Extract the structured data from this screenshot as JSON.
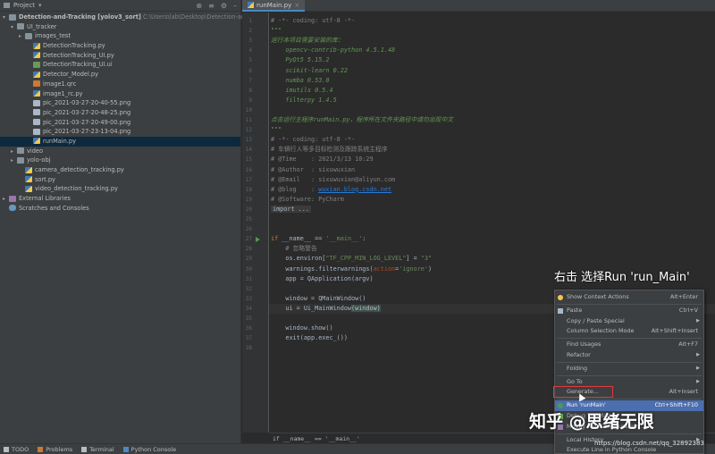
{
  "project": {
    "header_label": "Project",
    "tree": [
      {
        "depth": 0,
        "arrow": "▾",
        "icon": "folder",
        "label": "Detection-and-Tracking [yolov3_sort]",
        "extra": "C:\\Users\\lab\\Desktop\\Detection-and-Trac"
      },
      {
        "depth": 1,
        "arrow": "▾",
        "icon": "folder",
        "label": "UI_tracker"
      },
      {
        "depth": 2,
        "arrow": "▸",
        "icon": "folder",
        "label": "images_test"
      },
      {
        "depth": 3,
        "arrow": "",
        "icon": "py",
        "label": "DetectionTracking.py"
      },
      {
        "depth": 3,
        "arrow": "",
        "icon": "py",
        "label": "DetectionTracking_UI.py"
      },
      {
        "depth": 3,
        "arrow": "",
        "icon": "ui",
        "label": "DetectionTracking_UI.ui"
      },
      {
        "depth": 3,
        "arrow": "",
        "icon": "py",
        "label": "Detector_Model.py"
      },
      {
        "depth": 3,
        "arrow": "",
        "icon": "qrc",
        "label": "image1.qrc"
      },
      {
        "depth": 3,
        "arrow": "",
        "icon": "py",
        "label": "image1_rc.py"
      },
      {
        "depth": 3,
        "arrow": "",
        "icon": "png",
        "label": "pic_2021-03-27-20-40-55.png"
      },
      {
        "depth": 3,
        "arrow": "",
        "icon": "png",
        "label": "pic_2021-03-27-20-48-25.png"
      },
      {
        "depth": 3,
        "arrow": "",
        "icon": "png",
        "label": "pic_2021-03-27-20-49-00.png"
      },
      {
        "depth": 3,
        "arrow": "",
        "icon": "png",
        "label": "pic_2021-03-27-23-13-04.png"
      },
      {
        "depth": 3,
        "arrow": "",
        "icon": "py",
        "label": "runMain.py",
        "selected": true
      },
      {
        "depth": 1,
        "arrow": "▸",
        "icon": "folder",
        "label": "video"
      },
      {
        "depth": 1,
        "arrow": "▸",
        "icon": "folder",
        "label": "yolo-obj"
      },
      {
        "depth": 2,
        "arrow": "",
        "icon": "py",
        "label": "camera_detection_tracking.py"
      },
      {
        "depth": 2,
        "arrow": "",
        "icon": "py",
        "label": "sort.py"
      },
      {
        "depth": 2,
        "arrow": "",
        "icon": "py",
        "label": "video_detection_tracking.py"
      },
      {
        "depth": 0,
        "arrow": "▸",
        "icon": "lib",
        "label": "External Libraries"
      },
      {
        "depth": 0,
        "arrow": "",
        "icon": "scratch",
        "label": "Scratches and Consoles"
      }
    ]
  },
  "editor": {
    "tab_label": "runMain.py",
    "lines": [
      {
        "n": "1",
        "parts": [
          [
            "c-comment",
            "# -*- coding: utf-8 -*-"
          ]
        ]
      },
      {
        "n": "2",
        "parts": [
          [
            "c-doc",
            "\"\"\""
          ]
        ]
      },
      {
        "n": "3",
        "parts": [
          [
            "c-doc",
            "运行本项目需要安装的库："
          ]
        ]
      },
      {
        "n": "4",
        "parts": [
          [
            "c-doc",
            "    opencv-contrib-python 4.5.1.48"
          ]
        ]
      },
      {
        "n": "5",
        "parts": [
          [
            "c-doc",
            "    PyQt5 5.15.2"
          ]
        ]
      },
      {
        "n": "6",
        "parts": [
          [
            "c-doc",
            "    scikit-learn 0.22"
          ]
        ]
      },
      {
        "n": "7",
        "parts": [
          [
            "c-doc",
            "    numba 0.53.0"
          ]
        ]
      },
      {
        "n": "8",
        "parts": [
          [
            "c-doc",
            "    imutils 0.5.4"
          ]
        ]
      },
      {
        "n": "9",
        "parts": [
          [
            "c-doc",
            "    filterpy 1.4.5"
          ]
        ]
      },
      {
        "n": "10",
        "parts": [
          [
            "c-doc",
            ""
          ]
        ]
      },
      {
        "n": "11",
        "parts": [
          [
            "c-doc",
            "点击运行主程序runMain.py，程序所在文件夹路径中请勿出现中文"
          ]
        ]
      },
      {
        "n": "12",
        "parts": [
          [
            "c-doc",
            "\"\"\""
          ]
        ]
      },
      {
        "n": "13",
        "parts": [
          [
            "c-comment",
            "# -*- coding: utf-8 -*-"
          ]
        ]
      },
      {
        "n": "14",
        "parts": [
          [
            "c-comment",
            "# 车辆行人等多目标检测及跟踪系统主程序"
          ]
        ]
      },
      {
        "n": "15",
        "parts": [
          [
            "c-comment",
            "# @Time    : 2021/3/13 10:29"
          ]
        ]
      },
      {
        "n": "16",
        "parts": [
          [
            "c-comment",
            "# @Author  : sixuwuxian"
          ]
        ]
      },
      {
        "n": "17",
        "parts": [
          [
            "c-comment",
            "# @Email   : sixuwuxian@aliyun.com"
          ]
        ]
      },
      {
        "n": "18",
        "parts": [
          [
            "c-comment",
            "# @blog    : "
          ],
          [
            "c-link",
            "wuxian.blog.csdn.net"
          ]
        ]
      },
      {
        "n": "19",
        "parts": [
          [
            "c-comment",
            "# @Software: PyCharm"
          ]
        ]
      },
      {
        "n": "20",
        "parts": [
          [
            "c-fold",
            "import ..."
          ]
        ]
      },
      {
        "n": "25",
        "parts": [
          [
            "c-plain",
            ""
          ]
        ]
      },
      {
        "n": "26",
        "parts": [
          [
            "c-plain",
            ""
          ]
        ]
      },
      {
        "n": "27",
        "parts": [
          [
            "c-kw",
            "if "
          ],
          [
            "c-plain",
            "__name__ == "
          ],
          [
            "c-str",
            "'__main__'"
          ],
          [
            "c-plain",
            ":"
          ]
        ]
      },
      {
        "n": "28",
        "parts": [
          [
            "c-comment",
            "    # 忽略警告"
          ]
        ]
      },
      {
        "n": "29",
        "parts": [
          [
            "c-plain",
            "    os.environ["
          ],
          [
            "c-str",
            "\"TF_CPP_MIN_LOG_LEVEL\""
          ],
          [
            "c-plain",
            "] = "
          ],
          [
            "c-str",
            "\"3\""
          ]
        ]
      },
      {
        "n": "30",
        "parts": [
          [
            "c-plain",
            "    warnings.filterwarnings("
          ],
          [
            "c-param",
            "action"
          ],
          [
            "c-plain",
            "="
          ],
          [
            "c-str",
            "'ignore'"
          ],
          [
            "c-plain",
            ")"
          ]
        ]
      },
      {
        "n": "31",
        "parts": [
          [
            "c-plain",
            "    app = QApplication(argv)"
          ]
        ]
      },
      {
        "n": "32",
        "parts": [
          [
            "c-plain",
            ""
          ]
        ]
      },
      {
        "n": "33",
        "parts": [
          [
            "c-plain",
            "    window = QMainWindow()"
          ]
        ]
      },
      {
        "n": "34",
        "parts": [
          [
            "c-plain",
            "    ui = Ui_MainWindow"
          ],
          [
            "c-hl",
            "(window)"
          ]
        ],
        "current": true
      },
      {
        "n": "35",
        "parts": [
          [
            "c-plain",
            ""
          ]
        ]
      },
      {
        "n": "36",
        "parts": [
          [
            "c-plain",
            "    window.show()"
          ]
        ]
      },
      {
        "n": "37",
        "parts": [
          [
            "c-plain",
            "    exit(app.exec_())"
          ]
        ]
      },
      {
        "n": "38",
        "parts": [
          [
            "c-plain",
            ""
          ]
        ]
      }
    ],
    "breadcrumb": "if __name__ == '__main__'"
  },
  "context_menu": {
    "items": [
      {
        "label": "Show Context Actions",
        "shortcut": "Alt+Enter",
        "icon": "bulb"
      },
      {
        "sep": true
      },
      {
        "label": "Paste",
        "shortcut": "Ctrl+V",
        "icon": "paste"
      },
      {
        "label": "Copy / Paste Special",
        "submenu": true
      },
      {
        "label": "Column Selection Mode",
        "shortcut": "Alt+Shift+Insert"
      },
      {
        "sep": true
      },
      {
        "label": "Find Usages",
        "shortcut": "Alt+F7"
      },
      {
        "label": "Refactor",
        "submenu": true
      },
      {
        "sep": true
      },
      {
        "label": "Folding",
        "submenu": true
      },
      {
        "sep": true
      },
      {
        "label": "Go To",
        "submenu": true
      },
      {
        "label": "Generate...",
        "shortcut": "Alt+Insert"
      },
      {
        "sep": true
      },
      {
        "label": "Run 'runMain'",
        "shortcut": "Ctrl+Shift+F10",
        "icon": "run",
        "selected": true
      },
      {
        "label": "Debug 'runMain'",
        "icon": "debug"
      },
      {
        "label": "Modify Run Configuration...",
        "icon": "edit"
      },
      {
        "sep": true
      },
      {
        "label": "Local History",
        "submenu": true
      },
      {
        "label": "Execute Line in Python Console"
      }
    ]
  },
  "bottom_bar": {
    "items": [
      {
        "label": "TODO",
        "icon": "todo-icon",
        "color": "#bbbbbb"
      },
      {
        "label": "Problems",
        "icon": "problems-icon",
        "color": "#cc7832"
      },
      {
        "label": "Terminal",
        "icon": "terminal-icon",
        "color": "#bbbbbb"
      },
      {
        "label": "Python Console",
        "icon": "python-console-icon",
        "color": "#4a88c7"
      }
    ]
  },
  "overlay": {
    "caption": "右击 选择Run 'run_Main'",
    "watermark": "知乎 @思绪无限",
    "url": "https://blog.csdn.net/qq_32892383"
  },
  "colors": {
    "accent": "#4b6eaf",
    "highlight_box": "#e03a3a",
    "run_green": "#499c54"
  }
}
